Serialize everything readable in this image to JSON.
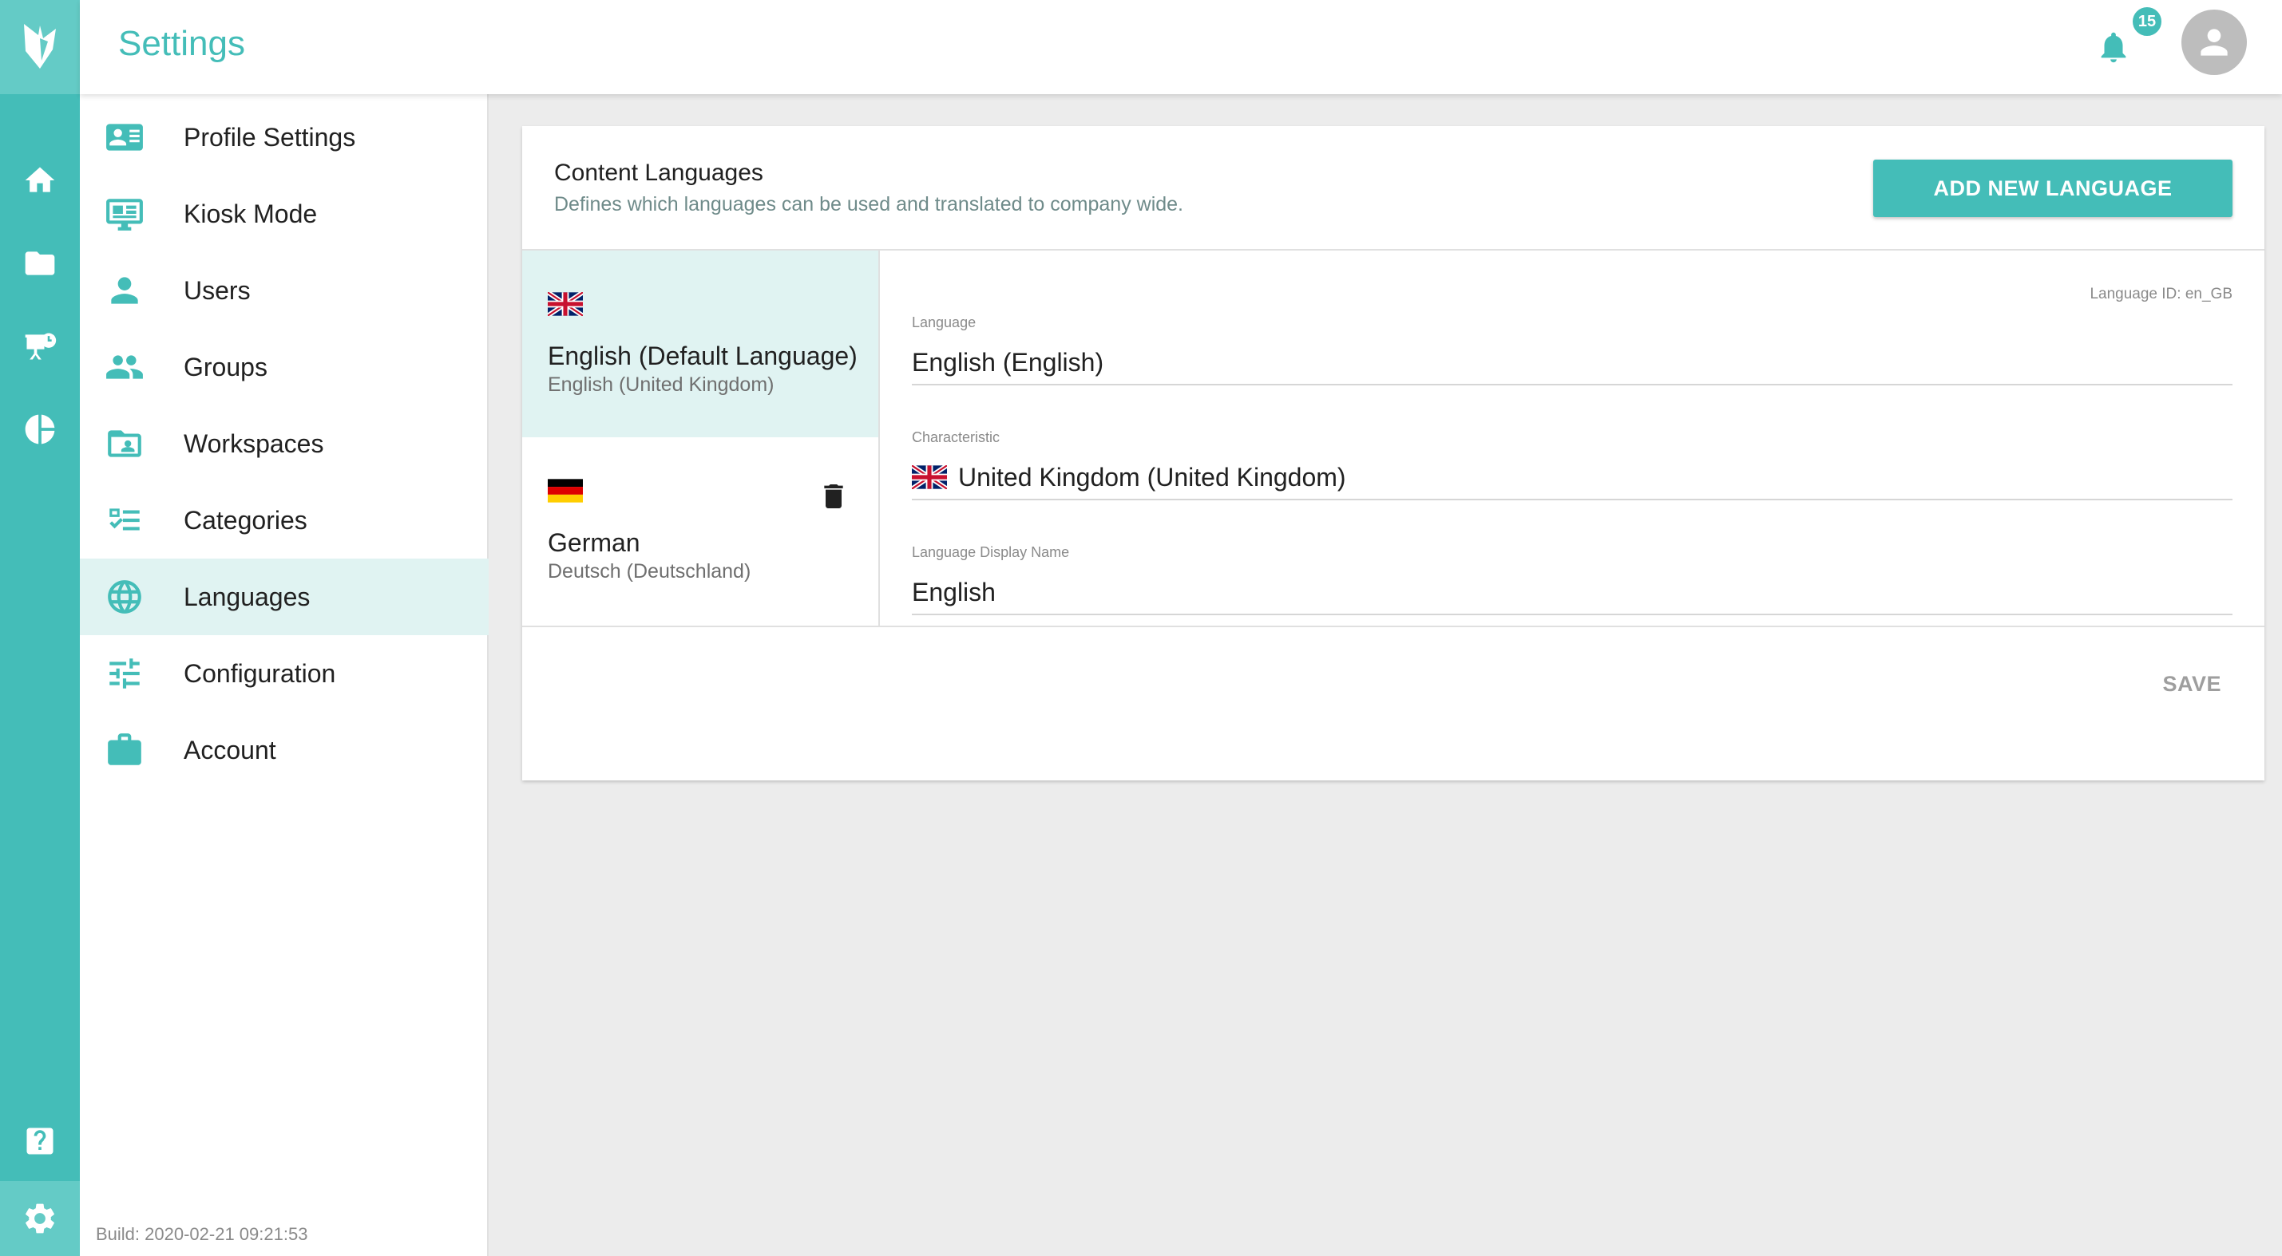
{
  "app": {
    "title": "Settings",
    "notification_count": "15",
    "accent_color": "#44bdb8"
  },
  "rail": {
    "icons": [
      "logo-icon",
      "home-icon",
      "folder-icon",
      "presentation-icon",
      "pie-chart-icon",
      "help-icon",
      "gear-icon"
    ]
  },
  "nav": {
    "items": [
      {
        "label": "Profile Settings",
        "icon": "profile-card-icon"
      },
      {
        "label": "Kiosk Mode",
        "icon": "monitor-icon"
      },
      {
        "label": "Users",
        "icon": "user-icon"
      },
      {
        "label": "Groups",
        "icon": "group-icon"
      },
      {
        "label": "Workspaces",
        "icon": "workspace-folder-icon"
      },
      {
        "label": "Categories",
        "icon": "checklist-icon"
      },
      {
        "label": "Languages",
        "icon": "globe-icon"
      },
      {
        "label": "Configuration",
        "icon": "sliders-icon"
      },
      {
        "label": "Account",
        "icon": "briefcase-icon"
      }
    ],
    "active": "Languages",
    "build": "Build: 2020-02-21 09:21:53"
  },
  "content": {
    "title": "Content Languages",
    "subtitle": "Defines which languages can be used and translated to company wide.",
    "add_button": "ADD NEW LANGUAGE",
    "languages": [
      {
        "name": "English (Default Language)",
        "native": "English (United Kingdom)",
        "flag": "uk-flag-icon",
        "selected": true
      },
      {
        "name": "German",
        "native": "Deutsch (Deutschland)",
        "flag": "germany-flag-icon",
        "selected": false
      }
    ],
    "detail": {
      "language_id": "Language ID: en_GB",
      "language_label": "Language",
      "language_value": "English (English)",
      "characteristic_label": "Characteristic",
      "characteristic_value": "United Kingdom (United Kingdom)",
      "display_name_label": "Language Display Name",
      "display_name_value": "English"
    },
    "save_button": "SAVE"
  }
}
